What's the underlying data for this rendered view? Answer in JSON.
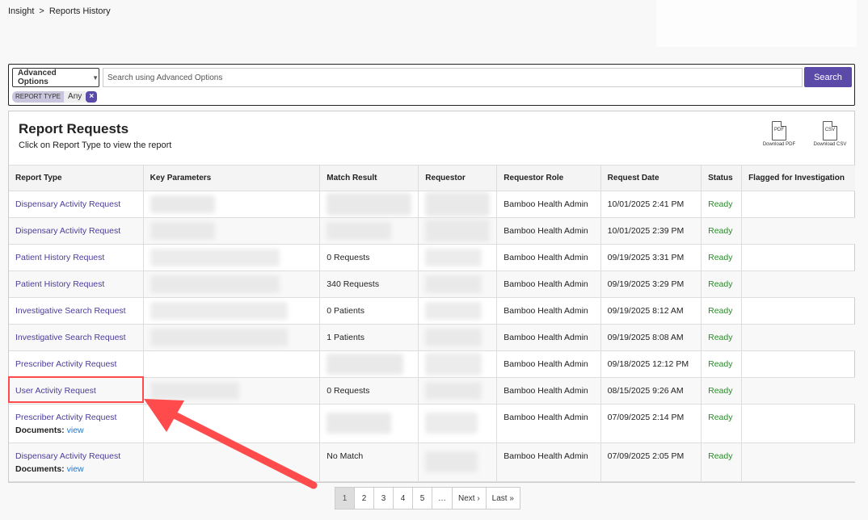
{
  "breadcrumb": {
    "root": "Insight",
    "separator": ">",
    "current": "Reports History"
  },
  "search": {
    "advanced_label": "Advanced Options",
    "placeholder": "Search using Advanced Options",
    "button_label": "Search",
    "filter": {
      "name": "Report Type",
      "value": "Any",
      "remove": "×"
    }
  },
  "panel": {
    "title": "Report Requests",
    "subtitle": "Click on Report Type to view the report",
    "download_pdf": {
      "icon_text": "PDF",
      "label": "Download PDF"
    },
    "download_csv": {
      "icon_text": "CSV",
      "label": "Download CSV"
    }
  },
  "table": {
    "headers": [
      "Report Type",
      "Key Parameters",
      "Match Result",
      "Requestor",
      "Requestor Role",
      "Request Date",
      "Status",
      "Flagged for Investigation"
    ],
    "documents_label": "Documents:",
    "view_label": "view",
    "rows": [
      {
        "type": "Dispensary Activity Request",
        "match": "",
        "role": "Bamboo Health Admin",
        "date": "10/01/2025 2:41 PM",
        "status": "Ready",
        "flagged": ""
      },
      {
        "type": "Dispensary Activity Request",
        "match": "",
        "role": "Bamboo Health Admin",
        "date": "10/01/2025 2:39 PM",
        "status": "Ready",
        "flagged": ""
      },
      {
        "type": "Patient History Request",
        "match": "0 Requests",
        "role": "Bamboo Health Admin",
        "date": "09/19/2025 3:31 PM",
        "status": "Ready",
        "flagged": ""
      },
      {
        "type": "Patient History Request",
        "match": "340 Requests",
        "role": "Bamboo Health Admin",
        "date": "09/19/2025 3:29 PM",
        "status": "Ready",
        "flagged": ""
      },
      {
        "type": "Investigative Search Request",
        "match": "0 Patients",
        "role": "Bamboo Health Admin",
        "date": "09/19/2025 8:12 AM",
        "status": "Ready",
        "flagged": ""
      },
      {
        "type": "Investigative Search Request",
        "match": "1 Patients",
        "role": "Bamboo Health Admin",
        "date": "09/19/2025 8:08 AM",
        "status": "Ready",
        "flagged": ""
      },
      {
        "type": "Prescriber Activity Request",
        "match": "",
        "role": "Bamboo Health Admin",
        "date": "09/18/2025 12:12 PM",
        "status": "Ready",
        "flagged": ""
      },
      {
        "type": "User Activity Request",
        "match": "0 Requests",
        "role": "Bamboo Health Admin",
        "date": "08/15/2025 9:26 AM",
        "status": "Ready",
        "flagged": ""
      },
      {
        "type": "Prescriber Activity Request",
        "match": "",
        "role": "Bamboo Health Admin",
        "date": "07/09/2025 2:14 PM",
        "status": "Ready",
        "flagged": ""
      },
      {
        "type": "Dispensary Activity Request",
        "match": "No Match",
        "role": "Bamboo Health Admin",
        "date": "07/09/2025 2:05 PM",
        "status": "Ready",
        "flagged": ""
      }
    ]
  },
  "pagination": {
    "pages": [
      "1",
      "2",
      "3",
      "4",
      "5",
      "…"
    ],
    "next": "Next ›",
    "last": "Last »",
    "current": "1"
  },
  "annotation": {
    "highlight_color": "#ff4b4b"
  },
  "colors": {
    "accent": "#5c4aa8",
    "link": "#4a3d9a",
    "ready": "#2a8a2a"
  }
}
